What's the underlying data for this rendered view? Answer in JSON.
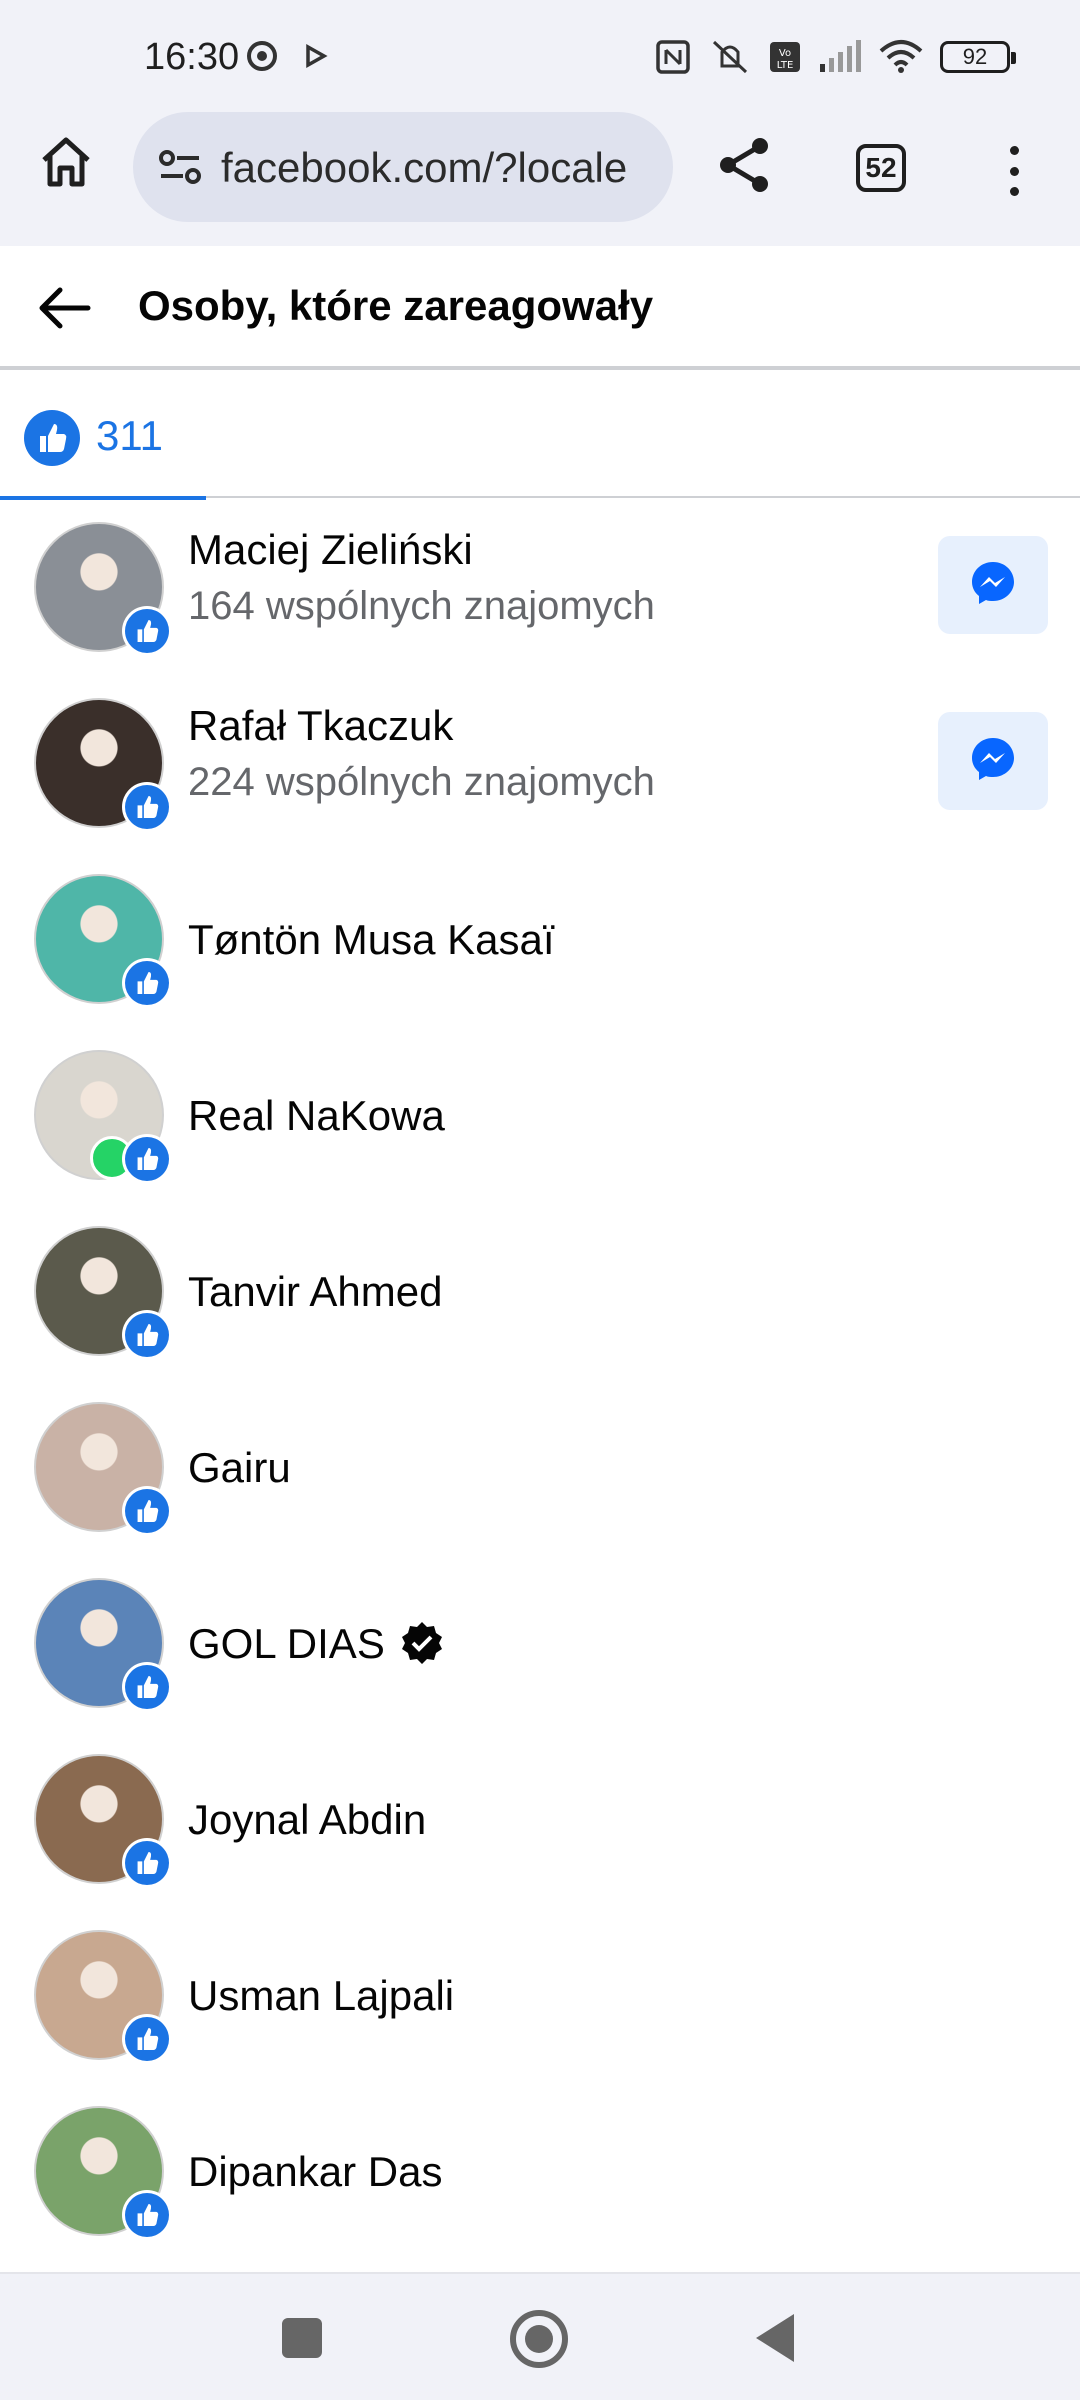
{
  "status_bar": {
    "time": "16:30",
    "battery": "92"
  },
  "browser": {
    "url": "facebook.com/?locale",
    "tab_count": "52"
  },
  "page": {
    "title": "Osoby, które zareagowały"
  },
  "reactions_tab": {
    "count": "311",
    "icon": "like-icon"
  },
  "reactors": [
    {
      "name": "Maciej Zieliński",
      "mutual": "164 wspólnych znajomych",
      "has_message_button": true,
      "avatar_color": "#8a8f96"
    },
    {
      "name": "Rafał Tkaczuk",
      "mutual": "224 wspólnych znajomych",
      "has_message_button": true,
      "avatar_color": "#3a2f2a"
    },
    {
      "name": "Tøntön Musa Kasaï",
      "mutual": "",
      "has_message_button": false,
      "avatar_color": "#4fb6a8"
    },
    {
      "name": "Real NaKowa",
      "mutual": "",
      "has_message_button": false,
      "avatar_color": "#d9d6cf"
    },
    {
      "name": "Tanvir Ahmed",
      "mutual": "",
      "has_message_button": false,
      "avatar_color": "#5b5a4c"
    },
    {
      "name": "Gairu",
      "mutual": "",
      "has_message_button": false,
      "avatar_color": "#c9b2a6"
    },
    {
      "name": "GOL DIAS",
      "mutual": "",
      "has_message_button": false,
      "verified": true,
      "avatar_color": "#5b84b8"
    },
    {
      "name": "Joynal Abdin",
      "mutual": "",
      "has_message_button": false,
      "avatar_color": "#8a6a50"
    },
    {
      "name": "Usman Lajpali",
      "mutual": "",
      "has_message_button": false,
      "avatar_color": "#c8a890"
    },
    {
      "name": "Dipankar Das",
      "mutual": "",
      "has_message_button": false,
      "avatar_color": "#7aa36a"
    }
  ],
  "colors": {
    "accent": "#1b74e4",
    "messenger_bg": "#e7f0fd"
  }
}
